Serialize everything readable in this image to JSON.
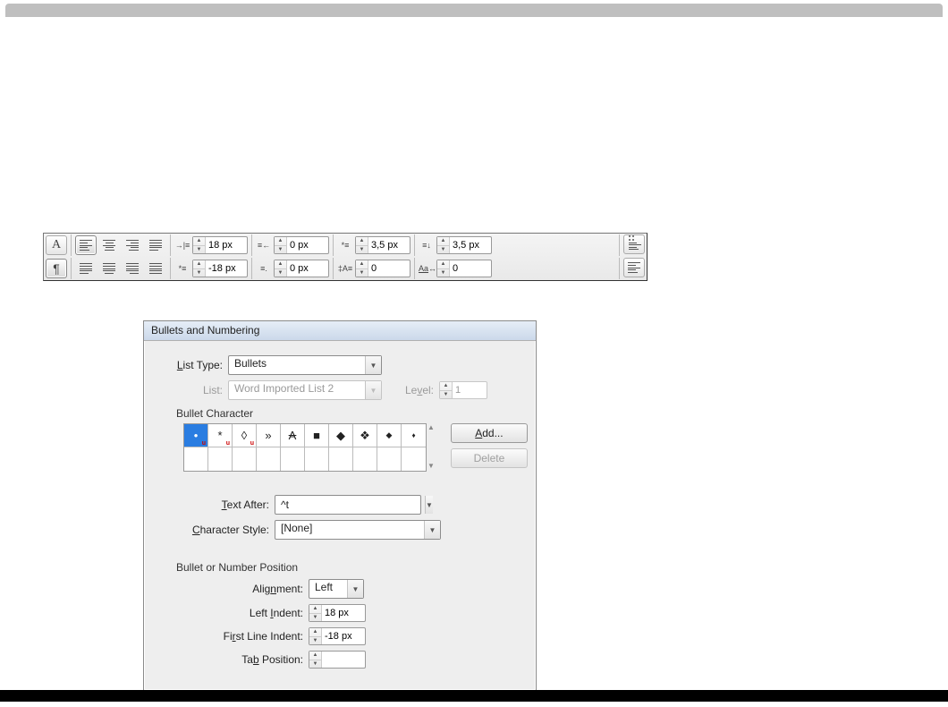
{
  "panel": {
    "row1": {
      "indent_left": "18 px",
      "indent_right": "0 px",
      "space_before": "3,5 px",
      "space_after": "3,5 px"
    },
    "row2": {
      "first_line": "-18 px",
      "last_line": "0 px",
      "autoleading": "0",
      "tracking": "0"
    }
  },
  "dialog": {
    "title": "Bullets and Numbering",
    "list_type_label": "List Type:",
    "list_type_value": "Bullets",
    "list_label": "List:",
    "list_value": "Word Imported List 2",
    "level_label": "Level:",
    "level_value": "1",
    "bullet_char_label": "Bullet Character",
    "bullet_chars": [
      "•",
      "*",
      "◊",
      "»",
      "A",
      "■",
      "◆",
      "❖",
      "◆",
      "♦"
    ],
    "add_label": "Add...",
    "delete_label": "Delete",
    "text_after_label": "Text After:",
    "text_after_value": "^t",
    "char_style_label": "Character Style:",
    "char_style_value": "[None]",
    "position_label": "Bullet or Number Position",
    "alignment_label": "Alignment:",
    "alignment_value": "Left",
    "left_indent_label": "Left Indent:",
    "left_indent_value": "18 px",
    "first_line_label": "First Line Indent:",
    "first_line_value": "-18 px",
    "tab_pos_label": "Tab Position:",
    "tab_pos_value": ""
  }
}
